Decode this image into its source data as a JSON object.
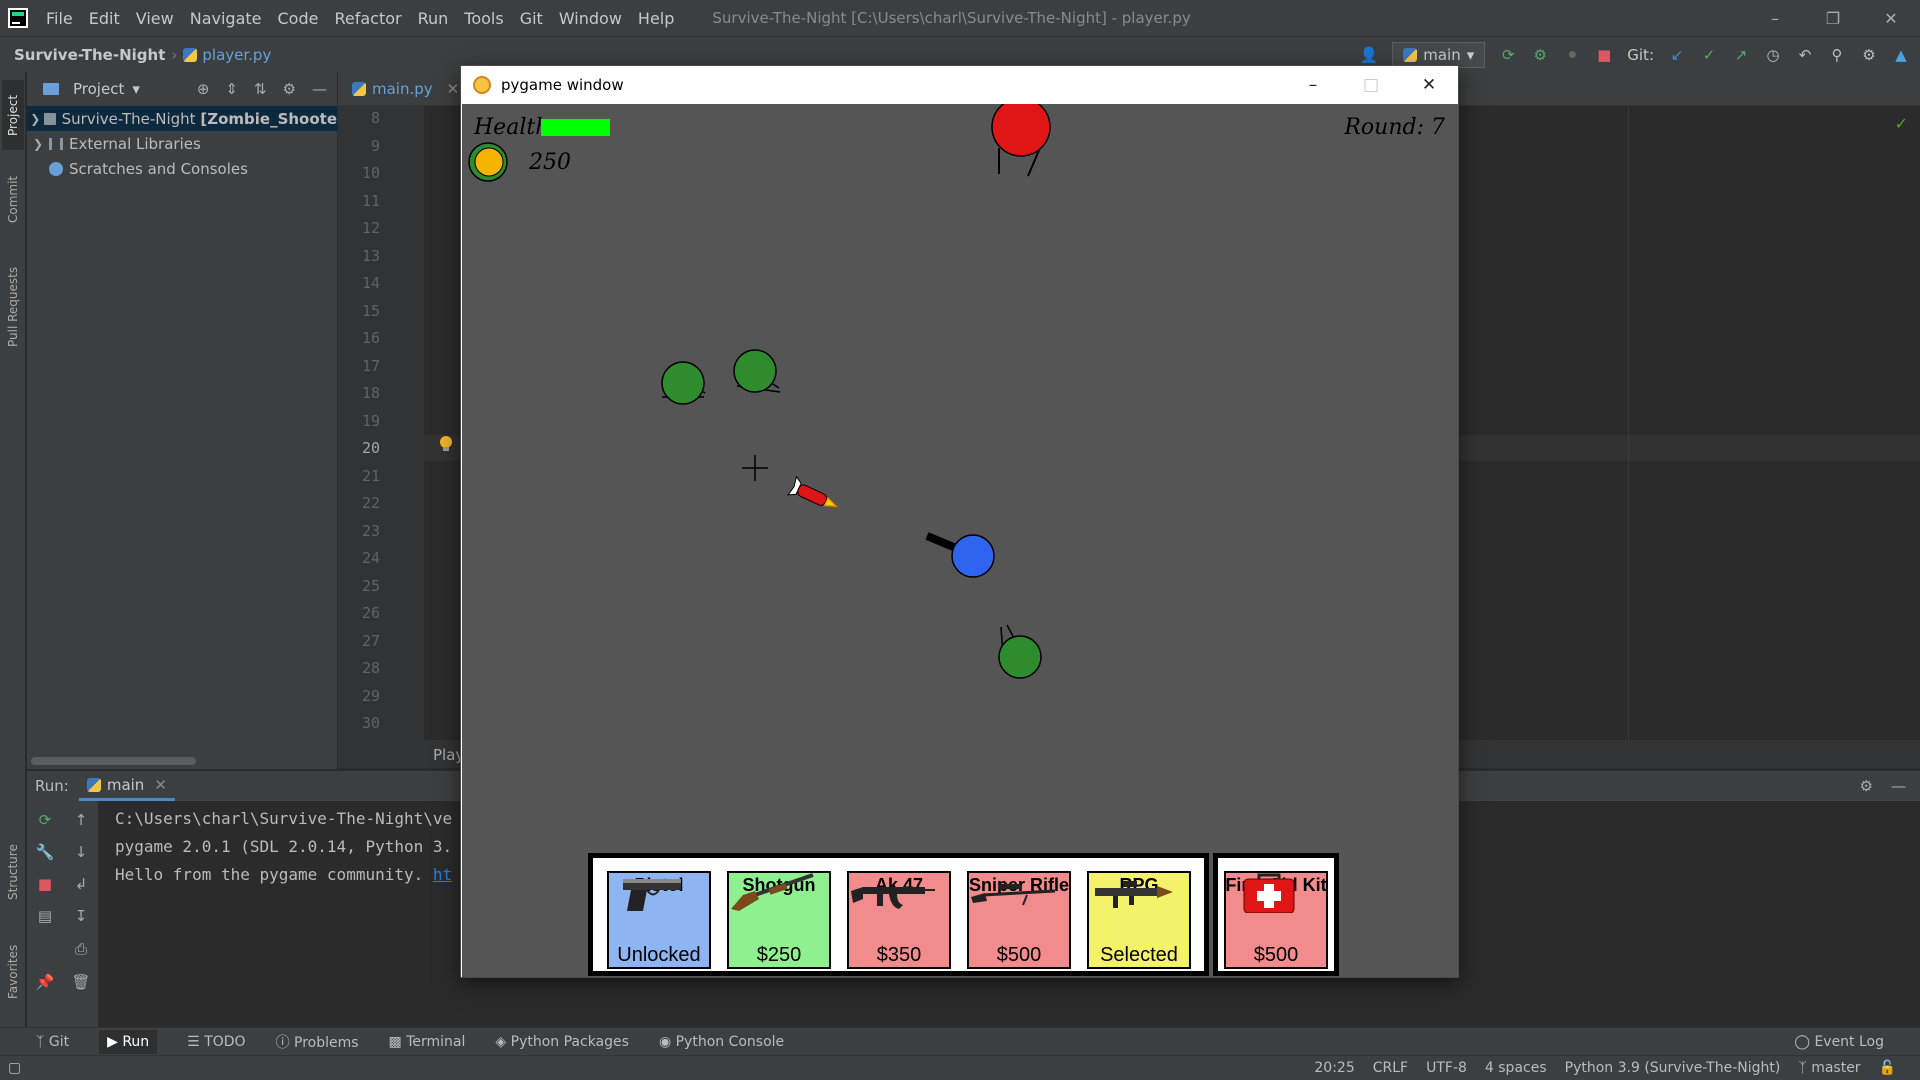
{
  "app": {
    "menu": [
      "File",
      "Edit",
      "View",
      "Navigate",
      "Code",
      "Refactor",
      "Run",
      "Tools",
      "Git",
      "Window",
      "Help"
    ],
    "window_title": "Survive-The-Night [C:\\Users\\charl\\Survive-The-Night] - player.py"
  },
  "navbar": {
    "project": "Survive-The-Night",
    "file": "player.py",
    "run_config": "main",
    "git_label": "Git:"
  },
  "project_panel": {
    "title": "Project",
    "tree": [
      {
        "label": "Survive-The-Night",
        "suffix": "[Zombie_Shoote"
      },
      {
        "label": "External Libraries"
      },
      {
        "label": "Scratches and Consoles"
      }
    ]
  },
  "editor": {
    "tab": "main.py",
    "line_numbers": [
      "8",
      "9",
      "10",
      "11",
      "12",
      "13",
      "14",
      "15",
      "16",
      "17",
      "18",
      "19",
      "20",
      "21",
      "22",
      "23",
      "24",
      "25",
      "26",
      "27",
      "28",
      "29",
      "30"
    ],
    "current_line": "20",
    "breadcrumb": "Play"
  },
  "left_stripe": [
    "Project",
    "Commit",
    "Pull Requests",
    "Structure",
    "Favorites"
  ],
  "run_panel": {
    "label": "Run:",
    "tab": "main",
    "console": [
      "C:\\Users\\charl\\Survive-The-Night\\ve",
      "pygame 2.0.1 (SDL 2.0.14, Python 3.",
      "Hello from the pygame community. "
    ],
    "console_link": "ht"
  },
  "bottom_tabs": [
    "Git",
    "Run",
    "TODO",
    "Problems",
    "Terminal",
    "Python Packages",
    "Python Console"
  ],
  "event_log": "Event Log",
  "status_bar": {
    "position": "20:25",
    "line_ending": "CRLF",
    "encoding": "UTF-8",
    "indent": "4 spaces",
    "interpreter": "Python 3.9 (Survive-The-Night)",
    "branch": "master"
  },
  "pygame": {
    "window_title": "pygame window",
    "hud": {
      "health_label": "Health:",
      "health_fraction": 1.0,
      "coins": "250",
      "round": "Round: 7"
    },
    "shop": [
      {
        "name": "Pistol",
        "status": "Unlocked",
        "color": "#8fb4f2",
        "icon": "pistol-icon"
      },
      {
        "name": "Shotgun",
        "status": "$250",
        "color": "#8ef08e",
        "icon": "shotgun-icon"
      },
      {
        "name": "Ak 47",
        "status": "$350",
        "color": "#f28b8b",
        "icon": "ak47-icon"
      },
      {
        "name": "Sniper Rifle",
        "status": "$500",
        "color": "#f28b8b",
        "icon": "sniper-icon"
      },
      {
        "name": "RPG",
        "status": "Selected",
        "color": "#f4f26b",
        "icon": "rpg-icon"
      }
    ],
    "first_aid": {
      "name": "First Aid Kit",
      "status": "$500",
      "color": "#f28b8b",
      "icon": "first-aid-icon"
    }
  },
  "colors": {
    "zombie": "#2e8b2e",
    "player": "#2f64f0",
    "boss": "#e01515",
    "coin": "#f5b400",
    "health_bar": "#00ff00"
  }
}
